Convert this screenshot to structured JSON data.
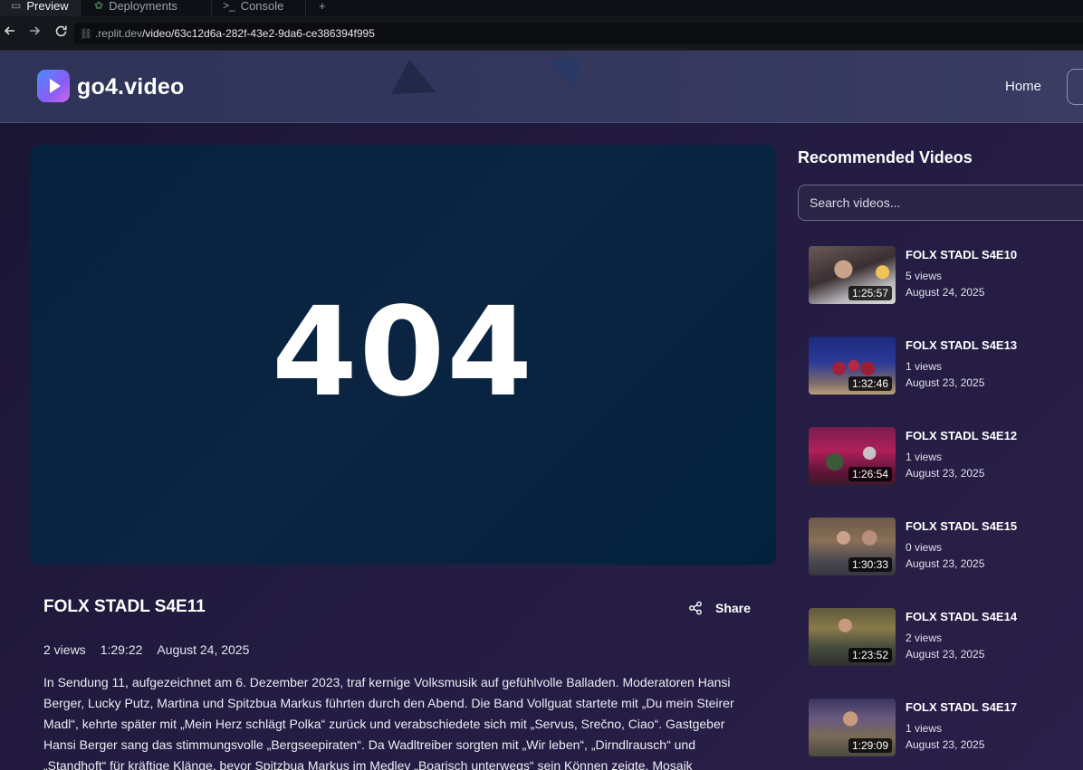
{
  "browser": {
    "tabs": [
      {
        "label": "Preview",
        "icon": "monitor-icon",
        "active": true
      },
      {
        "label": "Deployments",
        "icon": "deploy-icon",
        "active": false
      },
      {
        "label": "Console",
        "icon": "terminal-icon",
        "active": false
      }
    ],
    "new_tab": "+",
    "url_host": ".replit.dev",
    "url_path": "/video/63c12d6a-282f-43e2-9da6-ce386394f995"
  },
  "header": {
    "brand": "go4.video",
    "nav": [
      "Home"
    ],
    "accent": "#8a5cf6"
  },
  "player": {
    "error_code": "404"
  },
  "video": {
    "title": "FOLX STADL S4E11",
    "share_label": "Share",
    "views": "2 views",
    "duration": "1:29:22",
    "date": "August 24, 2025",
    "description": "In Sendung 11, aufgezeichnet am 6. Dezember 2023, traf kernige Volksmusik auf gefühlvolle Balladen. Moderatoren Hansi Berger, Lucky Putz, Martina und Spitzbua Markus führten durch den Abend. Die Band Vollguat startete mit „Du mein Steirer Madl“, kehrte später mit „Mein Herz schlägt Polka“ zurück und verabschiedete sich mit „Servus, Srečno, Ciao“. Gastgeber Hansi Berger sang das stimmungsvolle „Bergseepiraten“. Da Wadltreiber sorgten mit „Wir leben“, „Dirndlrausch“ und „Standhoft“ für kräftige Klänge, bevor Spitzbua Markus im Medley „Boarisch unterwegs“ sein Können zeigte. Mosaik präsentierten „Denn jetzt"
  },
  "sidebar": {
    "title": "Recommended Videos",
    "search_placeholder": "Search videos...",
    "items": [
      {
        "title": "FOLX STADL S4E10",
        "views": "5 views",
        "date": "August 24, 2025",
        "duration": "1:25:57"
      },
      {
        "title": "FOLX STADL S4E13",
        "views": "1 views",
        "date": "August 23, 2025",
        "duration": "1:32:46"
      },
      {
        "title": "FOLX STADL S4E12",
        "views": "1 views",
        "date": "August 23, 2025",
        "duration": "1:26:54"
      },
      {
        "title": "FOLX STADL S4E15",
        "views": "0 views",
        "date": "August 23, 2025",
        "duration": "1:30:33"
      },
      {
        "title": "FOLX STADL S4E14",
        "views": "2 views",
        "date": "August 23, 2025",
        "duration": "1:23:52"
      },
      {
        "title": "FOLX STADL S4E17",
        "views": "1 views",
        "date": "August 23, 2025",
        "duration": "1:29:09"
      }
    ]
  }
}
